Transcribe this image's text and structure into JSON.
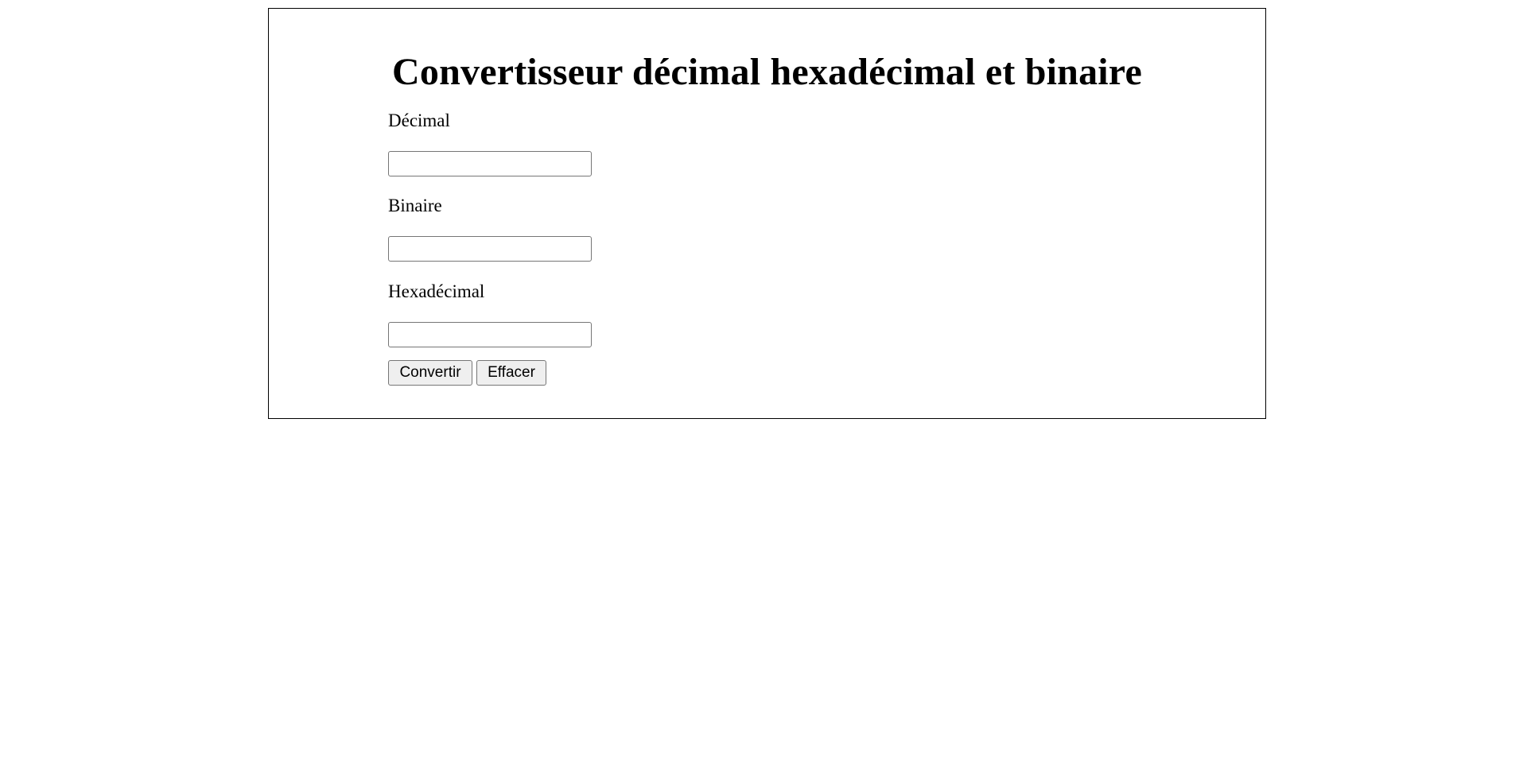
{
  "page": {
    "title": "Convertisseur décimal hexadécimal et binaire"
  },
  "form": {
    "decimal": {
      "label": "Décimal",
      "value": "",
      "placeholder": ""
    },
    "binary": {
      "label": "Binaire",
      "value": "",
      "placeholder": ""
    },
    "hex": {
      "label": "Hexadécimal",
      "value": "",
      "placeholder": ""
    },
    "buttons": {
      "convert_label": "Convertir",
      "clear_label": "Effacer"
    }
  }
}
